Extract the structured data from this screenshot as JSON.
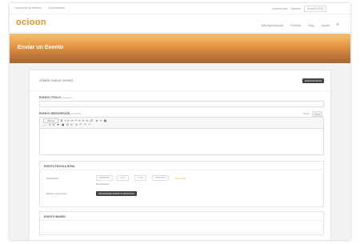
{
  "topbar": {
    "left_items": [
      "Calendario de eventos",
      "Comunidades"
    ],
    "right_items": [
      "Documentos",
      "Accesos"
    ],
    "language": "Español (ES)"
  },
  "header": {
    "logo": "ocioon",
    "nav": [
      "Mis espectáculos",
      "Eventos",
      "Blog",
      "Ayuda"
    ]
  },
  "banner": {
    "title": "Enviar un Evento"
  },
  "form": {
    "card_title": "Añadir nuevo evento",
    "submit_label": "ENVIAR EVENTO",
    "title_label": "EVENTO TÍTULO",
    "title_required": "(requerido)",
    "description_label": "EVENTO DESCRIPCIÓN",
    "description_required": "(requerido)",
    "editor_tabs": [
      "Visual",
      "Texto"
    ],
    "paragraph_select": "Párrafo",
    "toolbar_row1": [
      "B",
      "I",
      "≡",
      "≡",
      "❝",
      "≡",
      "≡",
      "≡",
      "🔗",
      "⊘",
      "≡",
      "▦"
    ],
    "toolbar_row2": [
      "—",
      "⇥",
      "A",
      "▼",
      "▣",
      "Ω",
      "⇤",
      "⇥",
      "↶",
      "↷",
      "?"
    ],
    "section_datetime": "EVENTO FECHA & HORA",
    "start_label": "Fecha/Hora:",
    "start_date": "28/07/2020",
    "start_time": "12:00",
    "end_time": "17:00",
    "end_date": "28/07/2020",
    "all_day_note": "Todo el día",
    "timezone": "Zona horaria:",
    "recurring_label": "Eventos recurrentes:",
    "recurring_button": "PROGRAMAR EVENTOS MÚLTIPLES",
    "section_images": "EVENTO IMAGEN"
  }
}
